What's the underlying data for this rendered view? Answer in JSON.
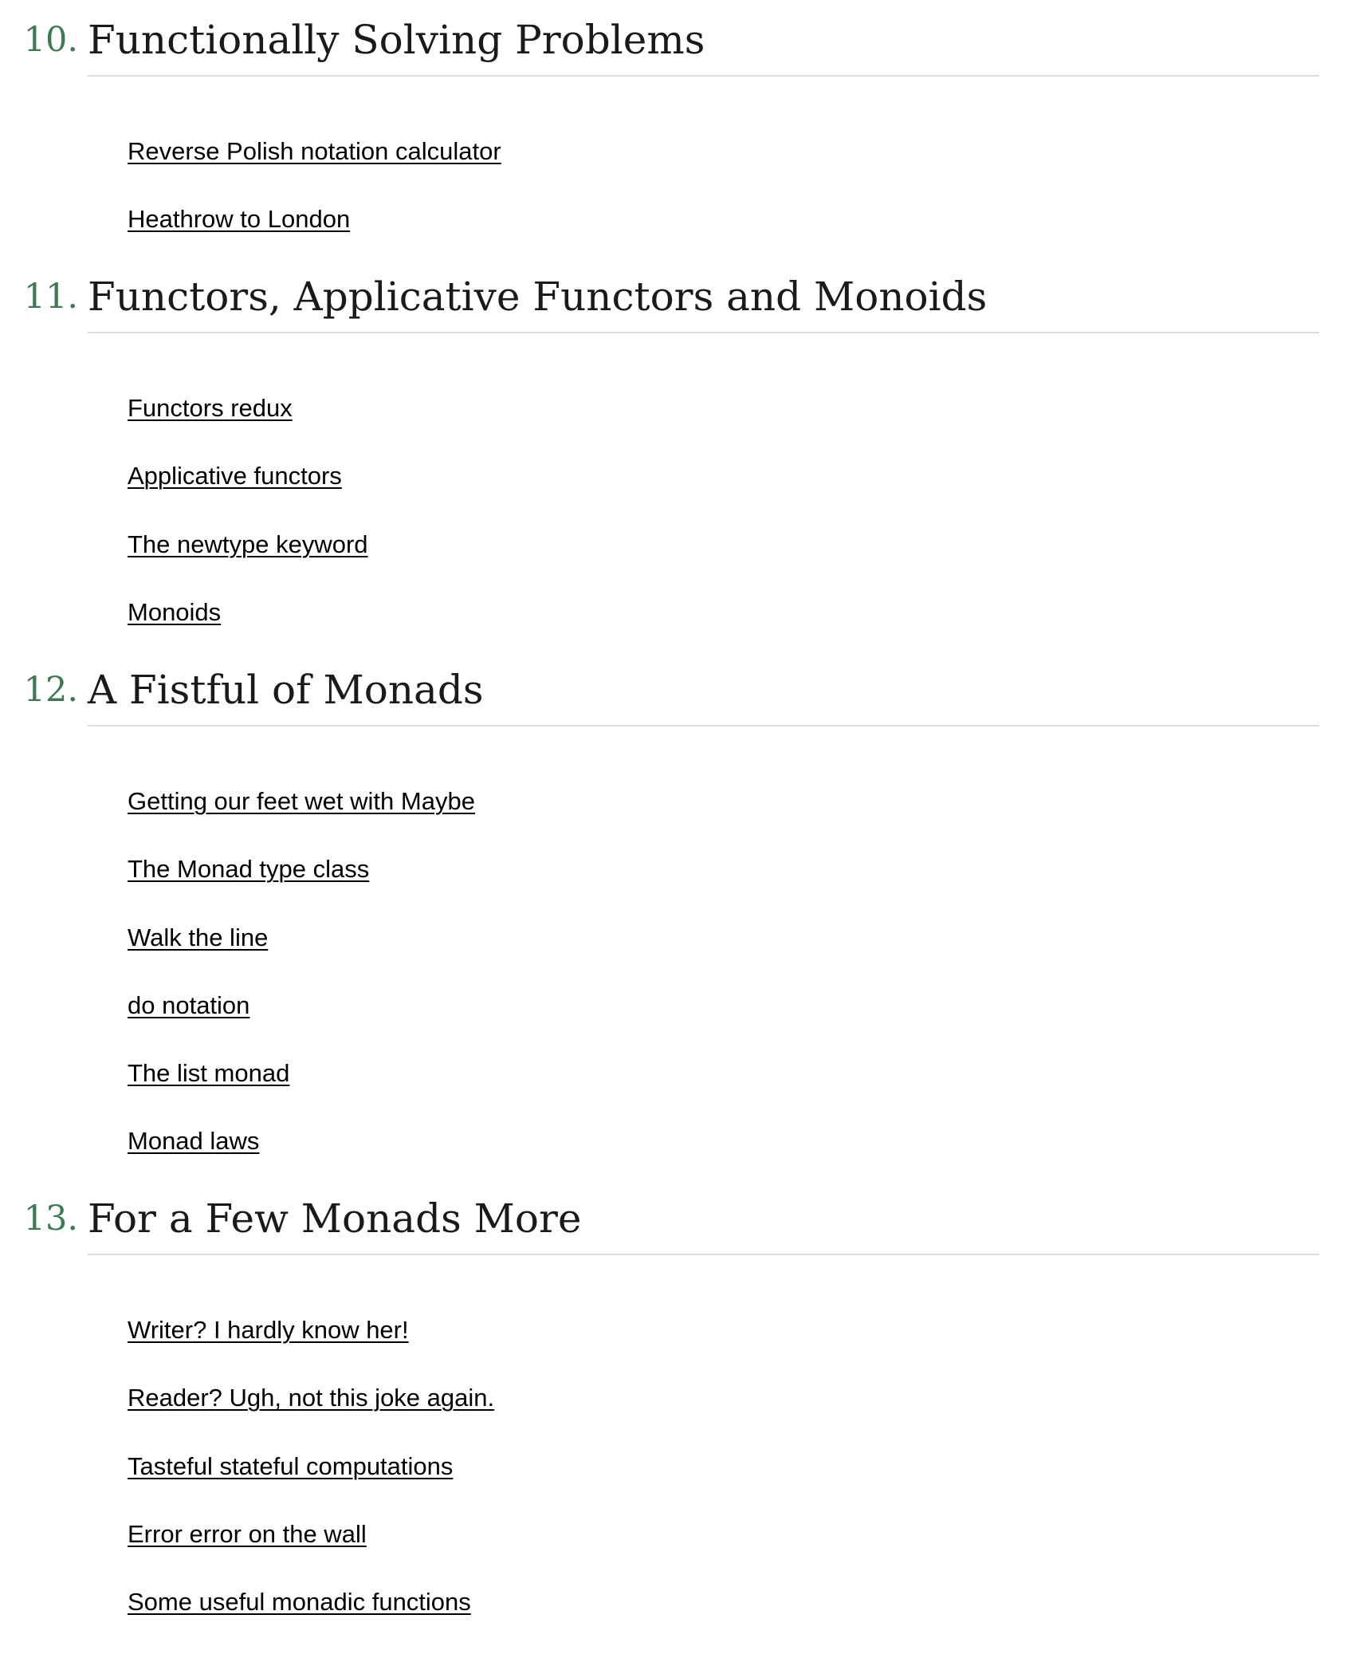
{
  "colors": {
    "chapter_number": "#3d7a52",
    "chapter_title": "#1a1a1a",
    "rule": "#dcdcdc",
    "link": "#000000",
    "background": "#ffffff"
  },
  "chapters": [
    {
      "number": "10.",
      "title": "Functionally Solving Problems",
      "sections": [
        "Reverse Polish notation calculator",
        "Heathrow to London"
      ]
    },
    {
      "number": "11.",
      "title": "Functors, Applicative Functors and Monoids",
      "sections": [
        "Functors redux",
        "Applicative functors",
        "The newtype keyword",
        "Monoids"
      ]
    },
    {
      "number": "12.",
      "title": "A Fistful of Monads",
      "sections": [
        "Getting our feet wet with Maybe",
        "The Monad type class",
        "Walk the line",
        "do notation",
        "The list monad",
        "Monad laws"
      ]
    },
    {
      "number": "13.",
      "title": "For a Few Monads More",
      "sections": [
        "Writer? I hardly know her!",
        "Reader? Ugh, not this joke again.",
        "Tasteful stateful computations",
        "Error error on the wall",
        "Some useful monadic functions"
      ]
    }
  ]
}
